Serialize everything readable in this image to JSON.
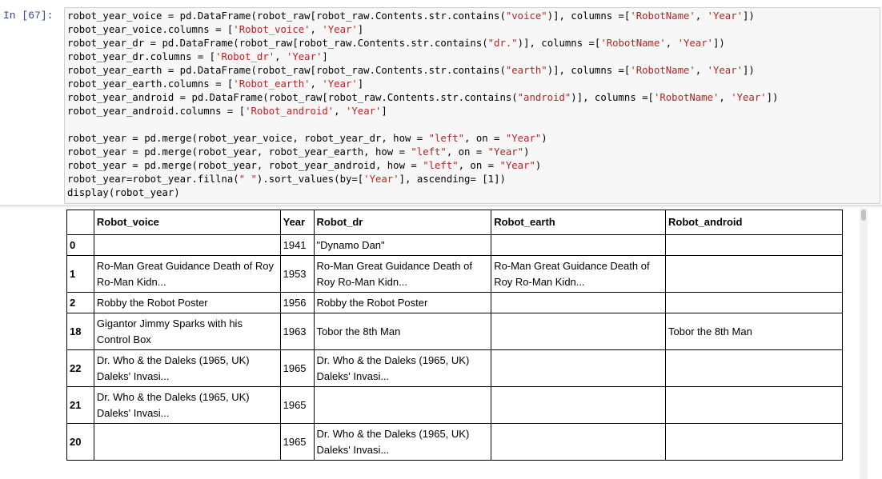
{
  "cell": {
    "prompt": "In [67]:",
    "code_lines": [
      [
        [
          "robot_year_voice = pd.DataFrame(robot_raw[robot_raw.Contents.str.contains(",
          ""
        ],
        [
          "\"voice\"",
          "s"
        ],
        [
          ")], columns =[",
          ""
        ],
        [
          "'RobotName'",
          "s"
        ],
        [
          ", ",
          ""
        ],
        [
          "'Year'",
          "s"
        ],
        [
          "])",
          ""
        ]
      ],
      [
        [
          "robot_year_voice.columns = [",
          ""
        ],
        [
          "'Robot_voice'",
          "s"
        ],
        [
          ", ",
          ""
        ],
        [
          "'Year'",
          "s"
        ],
        [
          "]",
          ""
        ]
      ],
      [
        [
          "robot_year_dr = pd.DataFrame(robot_raw[robot_raw.Contents.str.contains(",
          ""
        ],
        [
          "\"dr.\"",
          "s"
        ],
        [
          ")], columns =[",
          ""
        ],
        [
          "'RobotName'",
          "s"
        ],
        [
          ", ",
          ""
        ],
        [
          "'Year'",
          "s"
        ],
        [
          "])",
          ""
        ]
      ],
      [
        [
          "robot_year_dr.columns = [",
          ""
        ],
        [
          "'Robot_dr'",
          "s"
        ],
        [
          ", ",
          ""
        ],
        [
          "'Year'",
          "s"
        ],
        [
          "]",
          ""
        ]
      ],
      [
        [
          "robot_year_earth = pd.DataFrame(robot_raw[robot_raw.Contents.str.contains(",
          ""
        ],
        [
          "\"earth\"",
          "s"
        ],
        [
          ")], columns =[",
          ""
        ],
        [
          "'RobotName'",
          "s"
        ],
        [
          ", ",
          ""
        ],
        [
          "'Year'",
          "s"
        ],
        [
          "])",
          ""
        ]
      ],
      [
        [
          "robot_year_earth.columns = [",
          ""
        ],
        [
          "'Robot_earth'",
          "s"
        ],
        [
          ", ",
          ""
        ],
        [
          "'Year'",
          "s"
        ],
        [
          "]",
          ""
        ]
      ],
      [
        [
          "robot_year_android = pd.DataFrame(robot_raw[robot_raw.Contents.str.contains(",
          ""
        ],
        [
          "\"android\"",
          "s"
        ],
        [
          ")], columns =[",
          ""
        ],
        [
          "'RobotName'",
          "s"
        ],
        [
          ", ",
          ""
        ],
        [
          "'Year'",
          "s"
        ],
        [
          "])",
          ""
        ]
      ],
      [
        [
          "robot_year_android.columns = [",
          ""
        ],
        [
          "'Robot_android'",
          "s"
        ],
        [
          ", ",
          ""
        ],
        [
          "'Year'",
          "s"
        ],
        [
          "]",
          ""
        ]
      ],
      [],
      [
        [
          "robot_year = pd.merge(robot_year_voice, robot_year_dr, how = ",
          ""
        ],
        [
          "\"left\"",
          "s"
        ],
        [
          ", on = ",
          ""
        ],
        [
          "\"Year\"",
          "s"
        ],
        [
          ")",
          ""
        ]
      ],
      [
        [
          "robot_year = pd.merge(robot_year, robot_year_earth, how = ",
          ""
        ],
        [
          "\"left\"",
          "s"
        ],
        [
          ", on = ",
          ""
        ],
        [
          "\"Year\"",
          "s"
        ],
        [
          ")",
          ""
        ]
      ],
      [
        [
          "robot_year = pd.merge(robot_year, robot_year_android, how = ",
          ""
        ],
        [
          "\"left\"",
          "s"
        ],
        [
          ", on = ",
          ""
        ],
        [
          "\"Year\"",
          "s"
        ],
        [
          ")",
          ""
        ]
      ],
      [
        [
          "robot_year=robot_year.fillna(",
          ""
        ],
        [
          "\" \"",
          "s"
        ],
        [
          ").sort_values(by=[",
          ""
        ],
        [
          "'Year'",
          "s"
        ],
        [
          "], ascending= [1])",
          ""
        ]
      ],
      [
        [
          "display(robot_year)",
          ""
        ]
      ]
    ]
  },
  "table": {
    "columns": [
      "",
      "Robot_voice",
      "Year",
      "Robot_dr",
      "Robot_earth",
      "Robot_android"
    ],
    "rows": [
      {
        "index": "0",
        "voice": "",
        "year": "1941",
        "dr": "\"Dynamo Dan\"",
        "earth": "",
        "android": ""
      },
      {
        "index": "1",
        "voice": "Ro-Man Great Guidance Death of Roy Ro-Man Kidn...",
        "year": "1953",
        "dr": "Ro-Man Great Guidance Death of Roy Ro-Man Kidn...",
        "earth": "Ro-Man Great Guidance Death of Roy Ro-Man Kidn...",
        "android": ""
      },
      {
        "index": "2",
        "voice": "Robby the Robot Poster",
        "year": "1956",
        "dr": "Robby the Robot Poster",
        "earth": "",
        "android": ""
      },
      {
        "index": "18",
        "voice": "Gigantor Jimmy Sparks with his Control Box",
        "year": "1963",
        "dr": "Tobor the 8th Man",
        "earth": "",
        "android": "Tobor the 8th Man"
      },
      {
        "index": "22",
        "voice": "Dr. Who & the Daleks (1965, UK) Daleks' Invasi...",
        "year": "1965",
        "dr": "Dr. Who & the Daleks (1965, UK) Daleks' Invasi...",
        "earth": "",
        "android": ""
      },
      {
        "index": "21",
        "voice": "Dr. Who & the Daleks (1965, UK) Daleks' Invasi...",
        "year": "1965",
        "dr": "",
        "earth": "",
        "android": ""
      },
      {
        "index": "20",
        "voice": "",
        "year": "1965",
        "dr": "Dr. Who & the Daleks (1965, UK) Daleks' Invasi...",
        "earth": "",
        "android": ""
      }
    ]
  },
  "colors": {
    "prompt": "#303f9f",
    "string": "#ba2121",
    "code_bg": "#f7f7f7"
  }
}
